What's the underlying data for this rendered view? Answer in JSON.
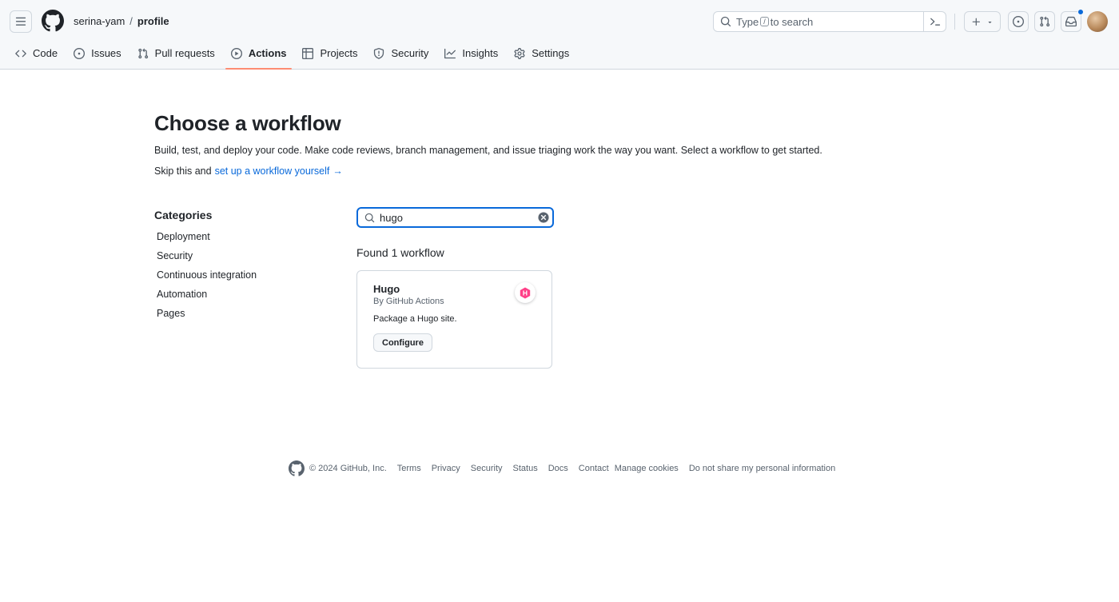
{
  "header": {
    "owner": "serina-yam",
    "separator": "/",
    "repo": "profile",
    "search": {
      "prefix": "Type",
      "key": "/",
      "suffix": "to search"
    }
  },
  "nav": {
    "tabs": [
      {
        "label": "Code",
        "icon": "code-icon"
      },
      {
        "label": "Issues",
        "icon": "issue-icon"
      },
      {
        "label": "Pull requests",
        "icon": "pull-request-icon"
      },
      {
        "label": "Actions",
        "icon": "play-icon",
        "active": true
      },
      {
        "label": "Projects",
        "icon": "table-icon"
      },
      {
        "label": "Security",
        "icon": "shield-icon"
      },
      {
        "label": "Insights",
        "icon": "graph-icon"
      },
      {
        "label": "Settings",
        "icon": "gear-icon"
      }
    ]
  },
  "main": {
    "title": "Choose a workflow",
    "description": "Build, test, and deploy your code. Make code reviews, branch management, and issue triaging work the way you want. Select a workflow to get started.",
    "skip_prefix": "Skip this and",
    "skip_link": "set up a workflow yourself",
    "skip_arrow": "→"
  },
  "categories": {
    "title": "Categories",
    "items": [
      "Deployment",
      "Security",
      "Continuous integration",
      "Automation",
      "Pages"
    ]
  },
  "workflow_search": {
    "value": "hugo",
    "found_text": "Found 1 workflow"
  },
  "workflow_card": {
    "name": "Hugo",
    "by": "By GitHub Actions",
    "description": "Package a Hugo site.",
    "configure_label": "Configure",
    "logo_letter": "H",
    "logo_color": "#ff4088"
  },
  "footer": {
    "copyright": "© 2024 GitHub, Inc.",
    "links": [
      "Terms",
      "Privacy",
      "Security",
      "Status",
      "Docs",
      "Contact",
      "Manage cookies",
      "Do not share my personal information"
    ]
  },
  "colors": {
    "accent": "#0969da",
    "active_tab_underline": "#fd8c73",
    "header_bg": "#f6f8fa",
    "border": "#d0d7de"
  }
}
